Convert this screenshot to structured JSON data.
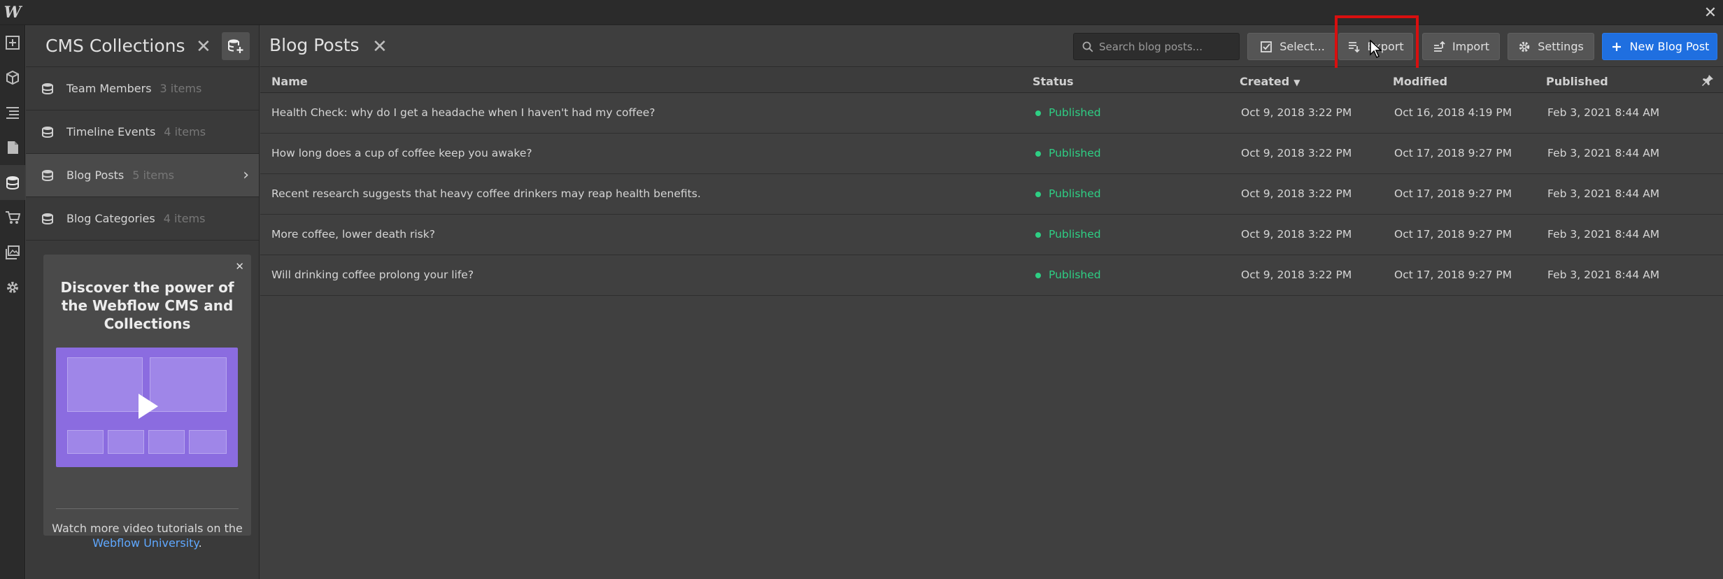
{
  "app": {
    "logo": "W",
    "close_glyph": "✕"
  },
  "collections_panel": {
    "title": "CMS Collections",
    "close_glyph": "✕",
    "items": [
      {
        "name": "Team Members",
        "count": "3 items"
      },
      {
        "name": "Timeline Events",
        "count": "4 items"
      },
      {
        "name": "Blog Posts",
        "count": "5 items"
      },
      {
        "name": "Blog Categories",
        "count": "4 items"
      }
    ],
    "active_index": 2
  },
  "promo": {
    "close_glyph": "✕",
    "title": "Discover the power of the Webflow CMS and Collections",
    "text": "Watch more video tutorials on the",
    "link": "Webflow University",
    "text_end": "."
  },
  "main": {
    "title": "Blog Posts",
    "close_glyph": "✕",
    "search_placeholder": "Search blog posts...",
    "buttons": {
      "select": "Select...",
      "export": "Export",
      "import": "Import",
      "settings": "Settings",
      "new_post": "New Blog Post"
    },
    "columns": {
      "name": "Name",
      "status": "Status",
      "created": "Created",
      "modified": "Modified",
      "published": "Published"
    },
    "rows": [
      {
        "name": "Health Check: why do I get a headache when I haven't had my coffee?",
        "status": "Published",
        "created": "Oct 9, 2018 3:22 PM",
        "modified": "Oct 16, 2018 4:19 PM",
        "published": "Feb 3, 2021 8:44 AM"
      },
      {
        "name": "How long does a cup of coffee keep you awake?",
        "status": "Published",
        "created": "Oct 9, 2018 3:22 PM",
        "modified": "Oct 17, 2018 9:27 PM",
        "published": "Feb 3, 2021 8:44 AM"
      },
      {
        "name": "Recent research suggests that heavy coffee drinkers may reap health benefits.",
        "status": "Published",
        "created": "Oct 9, 2018 3:22 PM",
        "modified": "Oct 17, 2018 9:27 PM",
        "published": "Feb 3, 2021 8:44 AM"
      },
      {
        "name": "More coffee, lower death risk?",
        "status": "Published",
        "created": "Oct 9, 2018 3:22 PM",
        "modified": "Oct 17, 2018 9:27 PM",
        "published": "Feb 3, 2021 8:44 AM"
      },
      {
        "name": "Will drinking coffee prolong your life?",
        "status": "Published",
        "created": "Oct 9, 2018 3:22 PM",
        "modified": "Oct 17, 2018 9:27 PM",
        "published": "Feb 3, 2021 8:44 AM"
      }
    ]
  },
  "colors": {
    "accent": "#1f6fe0",
    "published": "#2ecf84",
    "highlight": "#d80f0f",
    "promo": "#8b6ce0",
    "link": "#5fa8ff"
  }
}
